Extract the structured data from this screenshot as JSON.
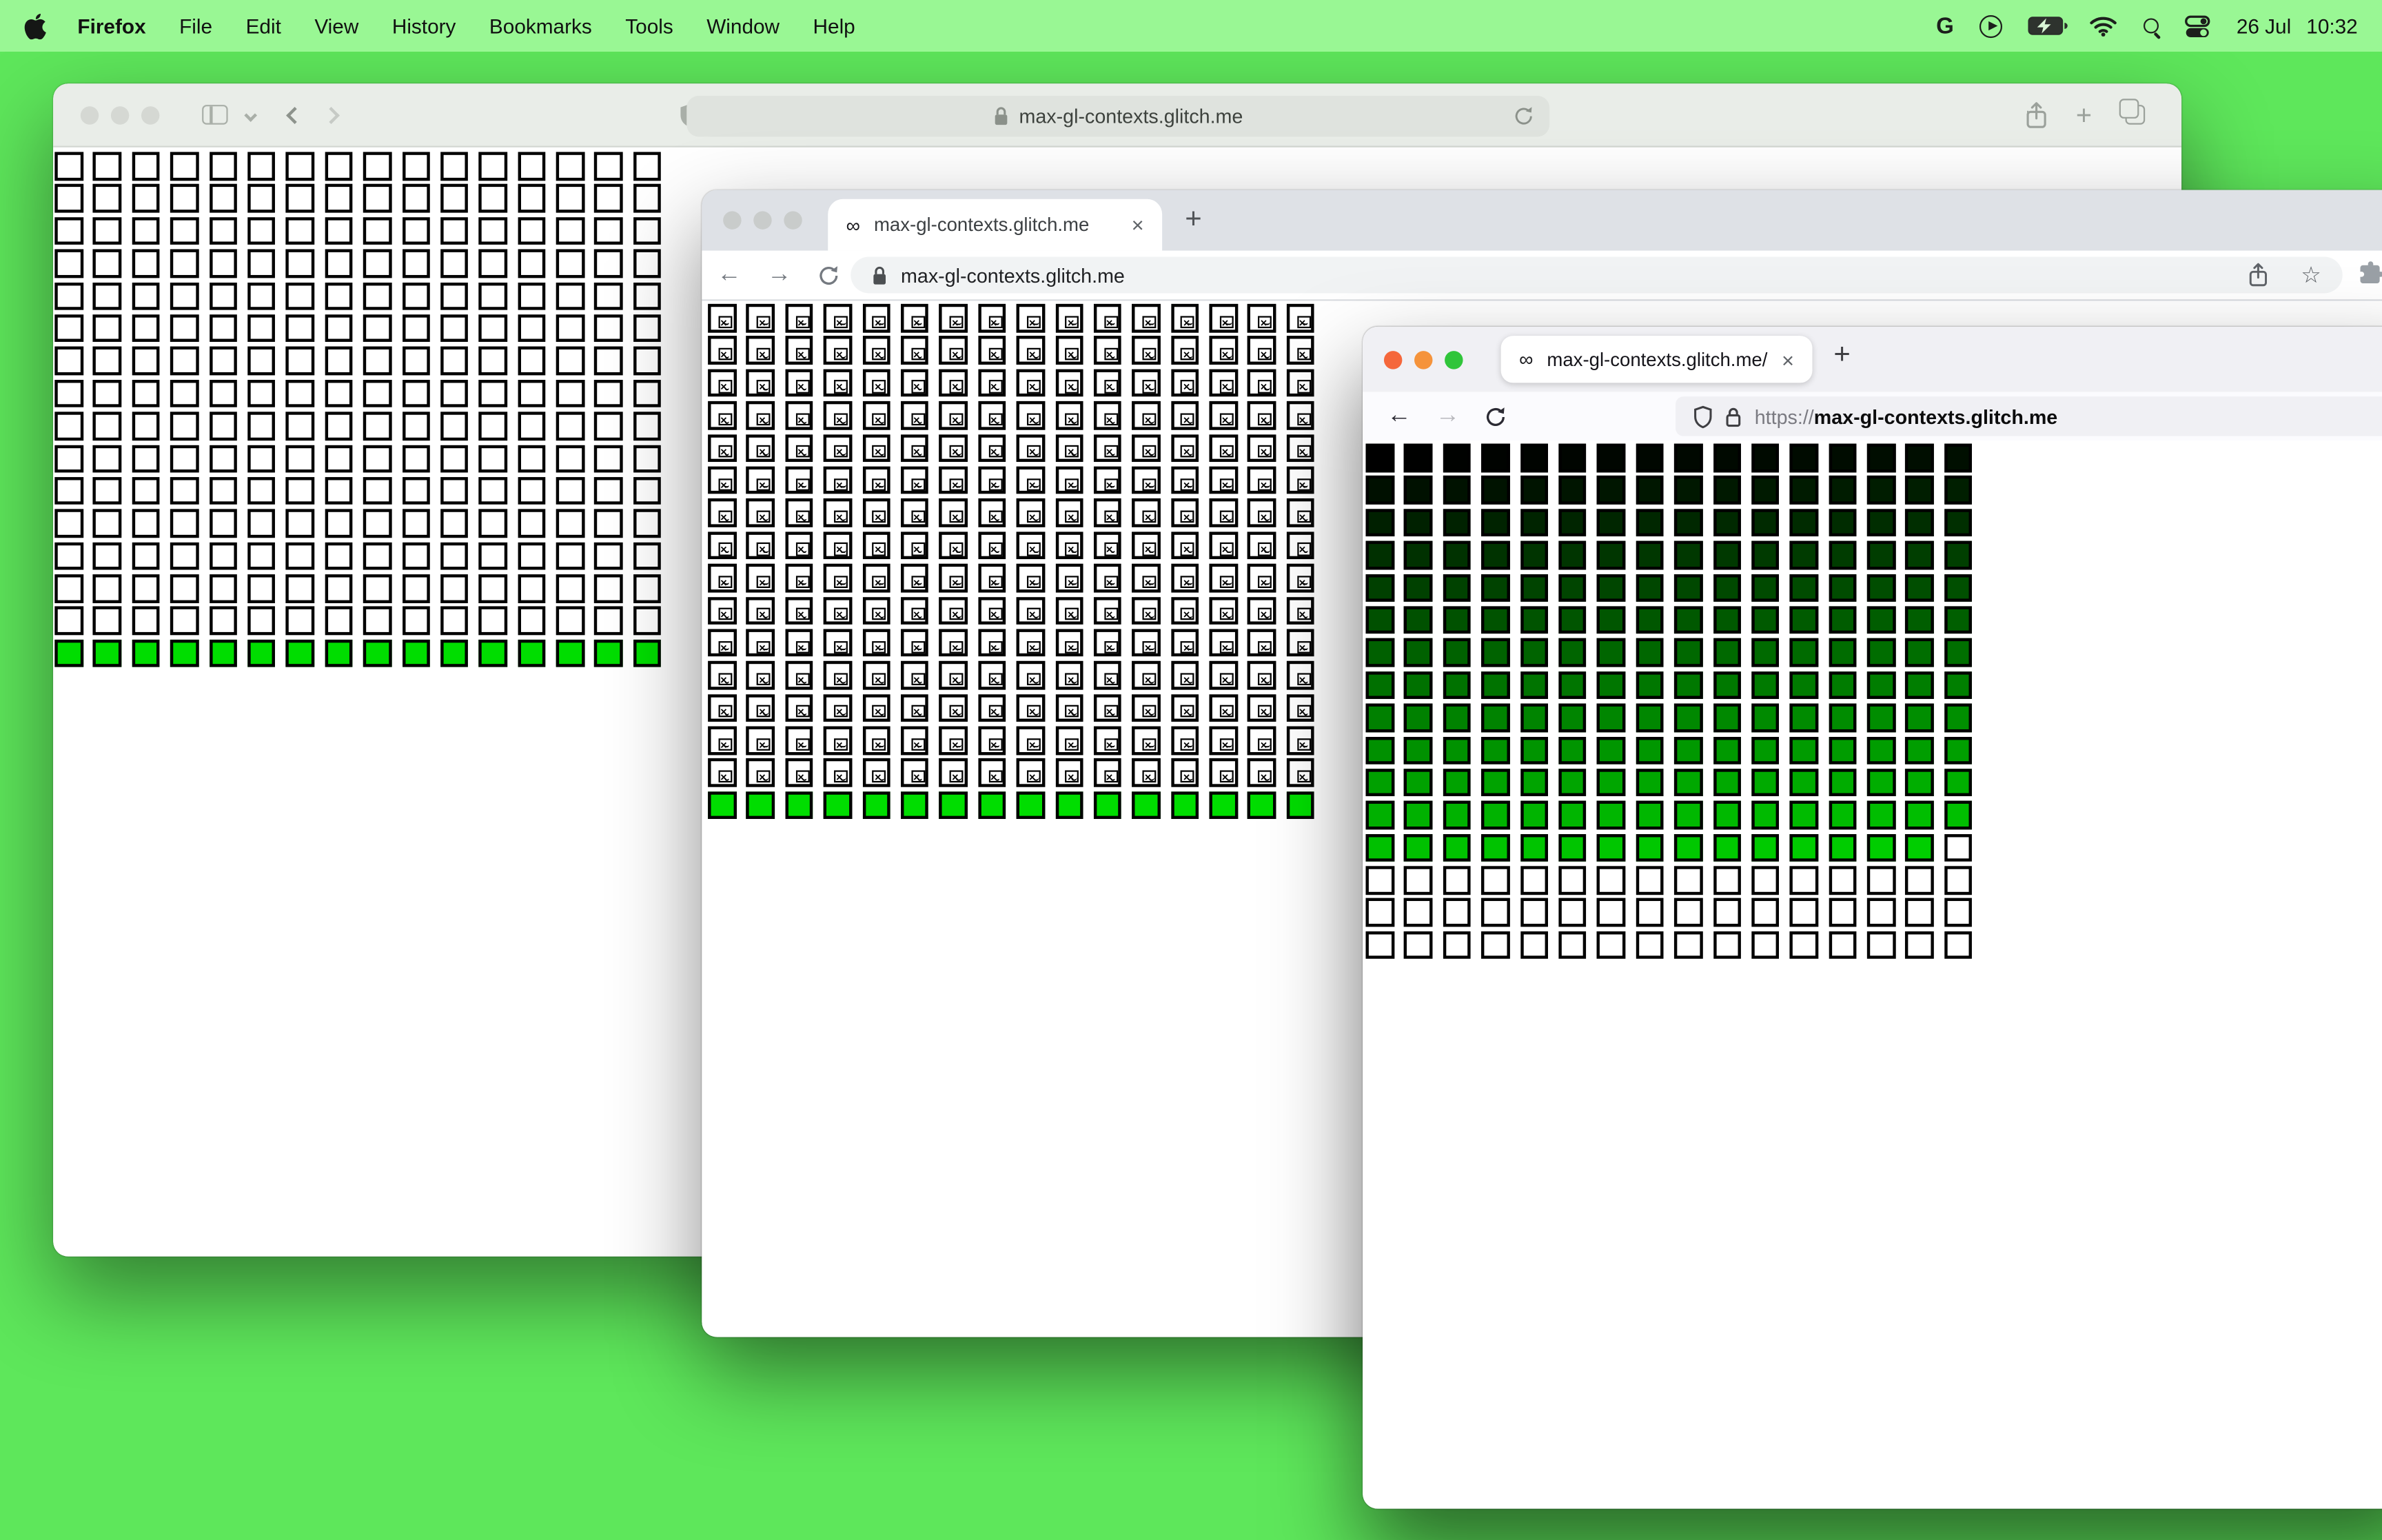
{
  "desktop": {
    "background_color": "#5ee75b"
  },
  "menu_bar": {
    "app_name": "Firefox",
    "items": [
      "File",
      "Edit",
      "View",
      "History",
      "Bookmarks",
      "Tools",
      "Window",
      "Help"
    ],
    "status_icons": [
      "google",
      "play",
      "battery-charging",
      "wifi",
      "search",
      "control-center"
    ],
    "date": "26 Jul",
    "time": "10:32"
  },
  "windows": {
    "safari": {
      "browser": "Safari",
      "active": false,
      "url": "max-gl-contexts.glitch.me"
    },
    "chrome": {
      "browser": "Chrome",
      "active": false,
      "favicon": "∞",
      "tab_title": "max-gl-contexts.glitch.me",
      "close_tab": "×",
      "new_tab": "+",
      "url": "max-gl-contexts.glitch.me"
    },
    "firefox": {
      "browser": "Firefox",
      "active": true,
      "favicon": "∞",
      "tab_title": "max-gl-contexts.glitch.me/",
      "close_tab": "×",
      "new_tab": "+",
      "url_scheme": "https://",
      "url_host": "max-gl-contexts.glitch.me"
    }
  },
  "grids": {
    "safari": {
      "cols": 16,
      "rows": 16,
      "style": "plain",
      "cell_background": "#ffffff",
      "bottom_row_color": "#00dd00",
      "border_color": "#000000"
    },
    "chrome": {
      "cols": 16,
      "rows": 16,
      "style": "broken",
      "cell_background": "#ffffff",
      "bottom_row_color": "#00dd00",
      "border_color": "#000000"
    },
    "firefox": {
      "cols": 16,
      "rows": 16,
      "style": "gradient",
      "colored_cells": 207,
      "color_rule": "rgb(0,cellIndex,0)",
      "white_after": "#ffffff",
      "border_color": "#000000"
    }
  }
}
